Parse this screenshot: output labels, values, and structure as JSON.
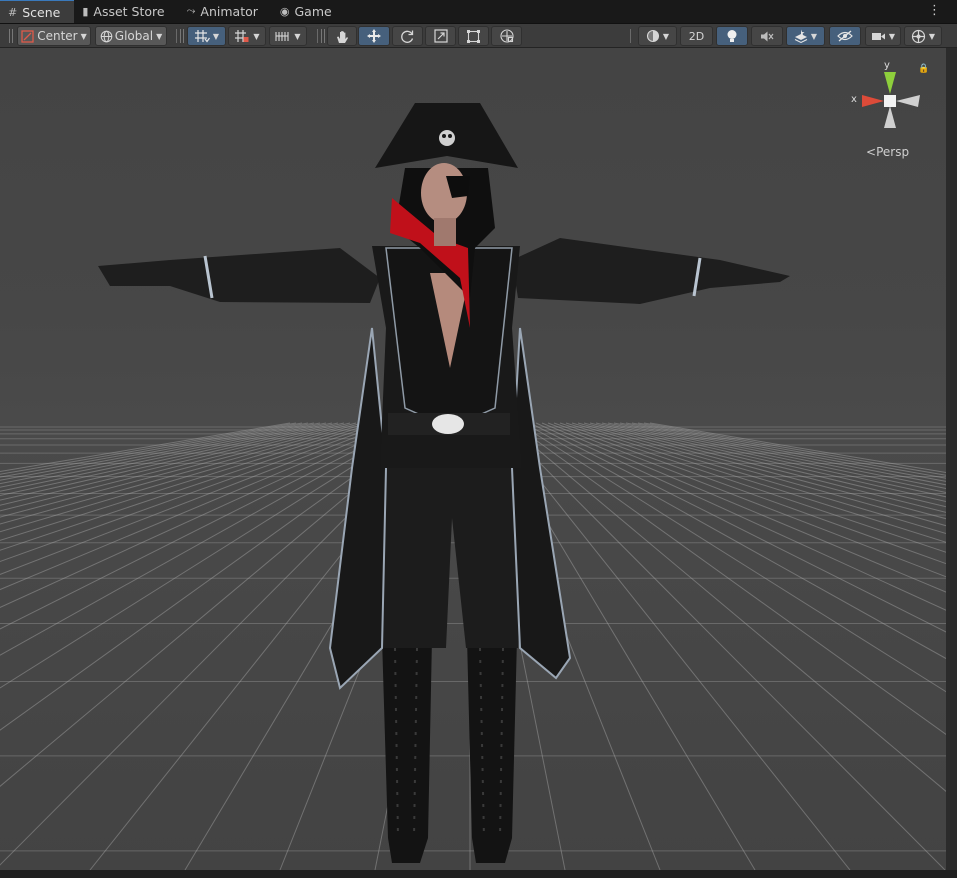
{
  "tabs": [
    {
      "label": "Scene",
      "icon": "grid-icon",
      "active": true
    },
    {
      "label": "Asset Store",
      "icon": "store-bag-icon",
      "active": false
    },
    {
      "label": "Animator",
      "icon": "animator-icon",
      "active": false
    },
    {
      "label": "Game",
      "icon": "gamepad-icon",
      "active": false
    }
  ],
  "tab_icons": {
    "scene": "#",
    "store": "▮",
    "animator": "⤳",
    "game": "◉"
  },
  "menu_dots": "⋮",
  "toolbar": {
    "pivot_label": "Center",
    "space_label": "Global",
    "mode_2d_label": "2D"
  },
  "gizmo": {
    "axis_y": "y",
    "axis_x": "x",
    "projection": "Persp",
    "colors": {
      "y": "#8ecf3c",
      "x": "#dd4b39",
      "z": "#d0d0d0",
      "center": "#f2f2f2"
    }
  },
  "colors": {
    "accent": "#3a79bb",
    "viewport_bg": "#474747",
    "active_button": "#46607c"
  }
}
